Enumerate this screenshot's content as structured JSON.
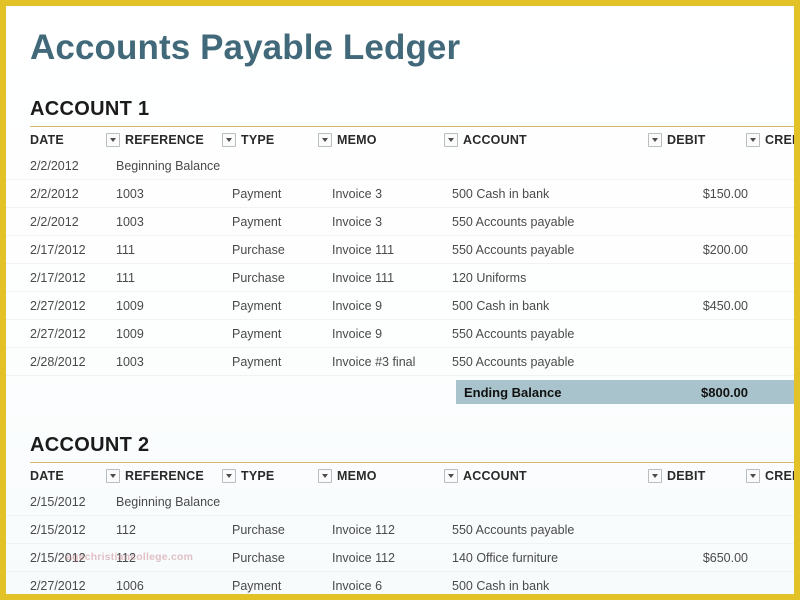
{
  "document": {
    "title": "Accounts Payable Ledger",
    "title_color": "#41697a",
    "frame_color": "#e3c227",
    "rule_color": "#d8b96a",
    "balance_row_color": "#a9c3cc"
  },
  "columns": [
    {
      "key": "date",
      "label": "DATE",
      "has_filter": false
    },
    {
      "key": "reference",
      "label": "REFERENCE",
      "has_filter": true
    },
    {
      "key": "type",
      "label": "TYPE",
      "has_filter": true
    },
    {
      "key": "memo",
      "label": "MEMO",
      "has_filter": true
    },
    {
      "key": "account",
      "label": "ACCOUNT",
      "has_filter": true
    },
    {
      "key": "debit",
      "label": "DEBIT",
      "has_filter": true
    },
    {
      "key": "credit",
      "label": "CREDIT",
      "has_filter": true
    }
  ],
  "sections": [
    {
      "heading": "ACCOUNT 1",
      "rows": [
        {
          "date": "2/2/2012",
          "reference": "Beginning Balance",
          "type": "",
          "memo": "",
          "account": "",
          "debit": "",
          "credit": "",
          "reference_is_label": true
        },
        {
          "date": "2/2/2012",
          "reference": "1003",
          "type": "Payment",
          "memo": "Invoice 3",
          "account": "500 Cash in bank",
          "debit": "$150.00",
          "credit": ""
        },
        {
          "date": "2/2/2012",
          "reference": "1003",
          "type": "Payment",
          "memo": "Invoice 3",
          "account": "550 Accounts payable",
          "debit": "",
          "credit": ""
        },
        {
          "date": "2/17/2012",
          "reference": "111",
          "type": "Purchase",
          "memo": "Invoice 111",
          "account": "550 Accounts payable",
          "debit": "$200.00",
          "credit": ""
        },
        {
          "date": "2/17/2012",
          "reference": "111",
          "type": "Purchase",
          "memo": "Invoice 111",
          "account": "120 Uniforms",
          "debit": "",
          "credit": ""
        },
        {
          "date": "2/27/2012",
          "reference": "1009",
          "type": "Payment",
          "memo": "Invoice 9",
          "account": "500 Cash in bank",
          "debit": "$450.00",
          "credit": ""
        },
        {
          "date": "2/27/2012",
          "reference": "1009",
          "type": "Payment",
          "memo": "Invoice 9",
          "account": "550 Accounts payable",
          "debit": "",
          "credit": ""
        },
        {
          "date": "2/28/2012",
          "reference": "1003",
          "type": "Payment",
          "memo": "Invoice #3 final",
          "account": "550 Accounts payable",
          "debit": "",
          "credit": ""
        }
      ],
      "ending_balance": {
        "label": "Ending Balance",
        "amount": "$800.00"
      }
    },
    {
      "heading": "ACCOUNT 2",
      "rows": [
        {
          "date": "2/15/2012",
          "reference": "Beginning Balance",
          "type": "",
          "memo": "",
          "account": "",
          "debit": "",
          "credit": "",
          "reference_is_label": true
        },
        {
          "date": "2/15/2012",
          "reference": "112",
          "type": "Purchase",
          "memo": "Invoice 112",
          "account": "550 Accounts payable",
          "debit": "",
          "credit": ""
        },
        {
          "date": "2/15/2012",
          "reference": "112",
          "type": "Purchase",
          "memo": "Invoice 112",
          "account": "140 Office furniture",
          "debit": "$650.00",
          "credit": ""
        },
        {
          "date": "2/27/2012",
          "reference": "1006",
          "type": "Payment",
          "memo": "Invoice 6",
          "account": "500 Cash in bank",
          "debit": "",
          "credit": ""
        }
      ],
      "ending_balance": null
    }
  ],
  "watermark": {
    "text": "agechristiancollege.com"
  }
}
